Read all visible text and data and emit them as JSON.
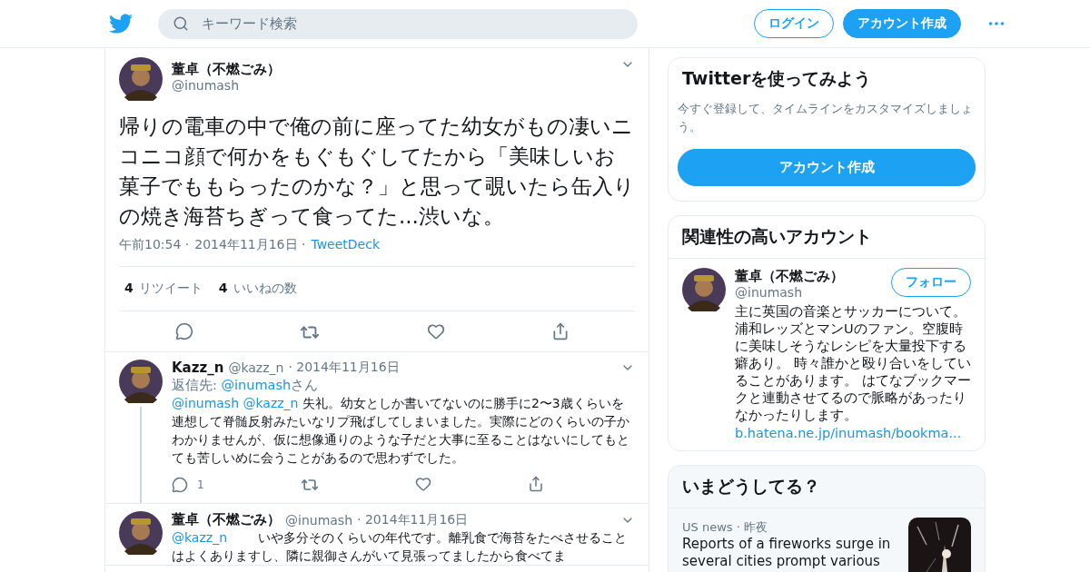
{
  "header": {
    "search": {
      "placeholder": "キーワード検索"
    },
    "login": "ログイン",
    "signup": "アカウント作成"
  },
  "main_tweet": {
    "author": "董卓（不燃ごみ）",
    "handle": "@inumash",
    "text": "帰りの電車の中で俺の前に座ってた幼女がもの凄いニコニコ顔で何かをもぐもぐしてたから「美味しいお菓子でももらったのかな？」と思って覗いたら缶入りの焼き海苔ちぎって食ってた...渋いな。",
    "time": "午前10:54 ·",
    "date": "2014年11月16日 ·",
    "source": "TweetDeck",
    "stats": [
      {
        "count": "4",
        "label": "リツイート"
      },
      {
        "count": "4",
        "label": "いいねの数"
      }
    ]
  },
  "replies": [
    {
      "author": "Kazz_n",
      "handle": "@kazz_n",
      "date": "· 2014年11月16日",
      "reply_to": {
        "prefix": "返信先:",
        "handle": "@inumash",
        "suffix": "さん"
      },
      "mentions": [
        "@inumash",
        "@kazz_n"
      ],
      "text": "失礼。幼女としか書いてないのに勝手に2〜3歳くらいを連想して脊髄反射みたいなリプ飛ばしてしまいました。実際にどのくらいの子かわかりませんが、仮に想像通りのような子だと大事に至ることはないにしてもとても苦しいめに会うことがあるので思わずでした。",
      "reply_count": "1",
      "thread": true
    },
    {
      "author": "董卓（不燃ごみ）",
      "handle": "@inumash",
      "date": "· 2014年11月16日",
      "mentions": [
        "@kazz_n"
      ],
      "text": "いや多分そのくらいの年代です。離乳食で海苔をたべさせることはよくありますし、隣に親御さんがいて見張ってましたから食べてま",
      "thread": false
    }
  ],
  "signup_card": {
    "title": "Twitterを使ってみよう",
    "text": "今すぐ登録して、タイムラインをカスタマイズしましょう。",
    "button": "アカウント作成"
  },
  "related": {
    "title": "関連性の高いアカウント",
    "author": "董卓（不燃ごみ）",
    "handle": "@inumash",
    "follow": "フォロー",
    "bio": "主に英国の音楽とサッカーについて。浦和レッズとマンUのファン。空腹時に美味しそうなレシピを大量投下する癖あり。 時々誰かと殴り合いをしていることがあります。 はてなブックマークと連動させてるので脈略があったりなかったりします。",
    "link": "b.hatena.ne.jp/inumash/bookma..."
  },
  "trends": {
    "title": "いまどうしてる？",
    "items": [
      {
        "category": "US news",
        "time": "· 昨夜",
        "headline": "Reports of a fireworks surge in several cities prompt various"
      }
    ]
  }
}
